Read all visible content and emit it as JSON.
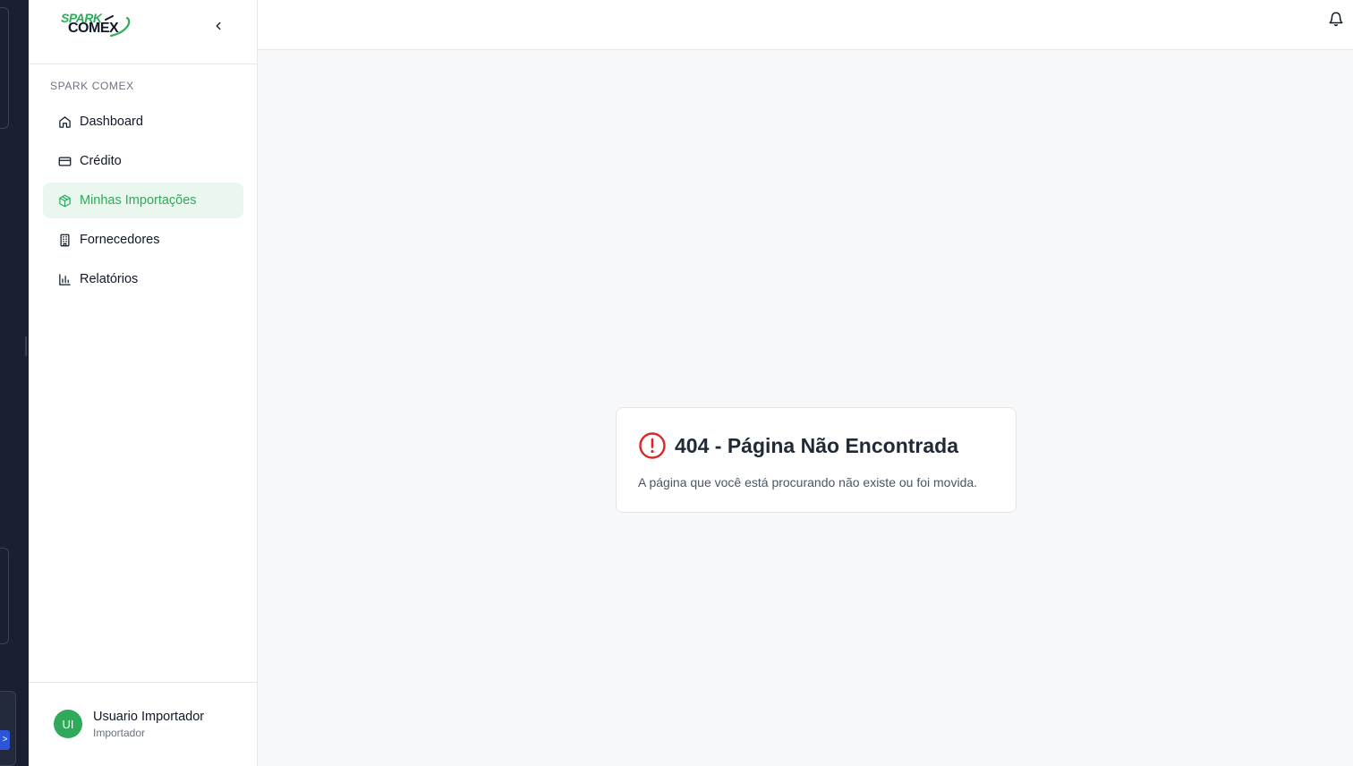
{
  "logo": {
    "line1": "SPARK",
    "line2": "COMEX"
  },
  "sidebar": {
    "section_label": "SPARK COMEX",
    "items": [
      {
        "label": "Dashboard",
        "icon": "home-icon"
      },
      {
        "label": "Crédito",
        "icon": "credit-card-icon"
      },
      {
        "label": "Minhas Importações",
        "icon": "package-icon",
        "active": true
      },
      {
        "label": "Fornecedores",
        "icon": "building-icon"
      },
      {
        "label": "Relatórios",
        "icon": "bar-chart-icon"
      }
    ]
  },
  "user": {
    "initials": "UI",
    "name": "Usuario Importador",
    "role": "Importador"
  },
  "error": {
    "title": "404 - Página Não Encontrada",
    "message": "A página que você está procurando não existe ou foi movida."
  },
  "colors": {
    "accent": "#2eaa5a",
    "error": "#dc2626",
    "active_bg": "#e9f7ee"
  }
}
